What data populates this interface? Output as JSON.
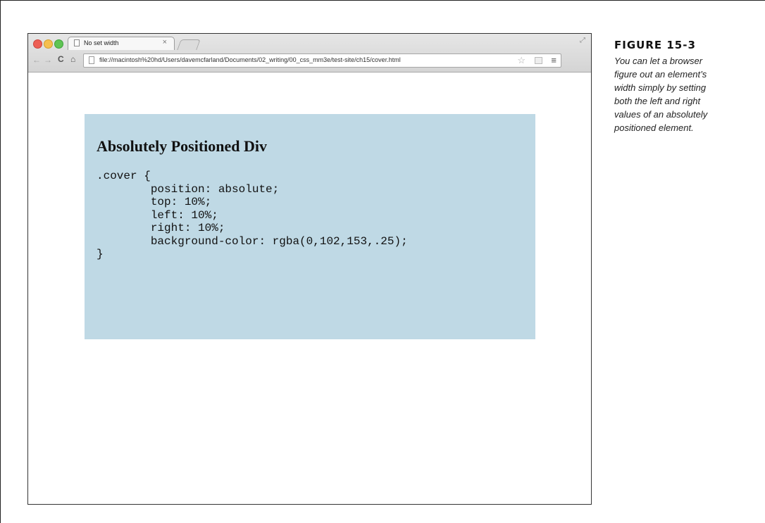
{
  "browser": {
    "tab_title": "No set width",
    "tab_close": "×",
    "url": "file://macintosh%20hd/Users/davemcfarland/Documents/02_writing/00_css_mm3e/test-site/ch15/cover.html",
    "icons": {
      "back": "back-arrow-icon",
      "forward": "forward-arrow-icon",
      "reload": "reload-icon",
      "home": "home-icon",
      "bookmark": "star-icon",
      "menu": "hamburger-menu-icon"
    }
  },
  "page": {
    "heading": "Absolutely Positioned Div",
    "code_lines": [
      ".cover {",
      "        position: absolute;",
      "        top: 10%;",
      "        left: 10%;",
      "        right: 10%;",
      "        background-color: rgba(0,102,153,.25);",
      "}"
    ]
  },
  "caption": {
    "label": "FIGURE 15-3",
    "lines": [
      "You can let a browser",
      "figure out an element’s",
      "width simply by setting",
      "both the left and right",
      "values of an absolutely",
      "positioned element."
    ]
  }
}
